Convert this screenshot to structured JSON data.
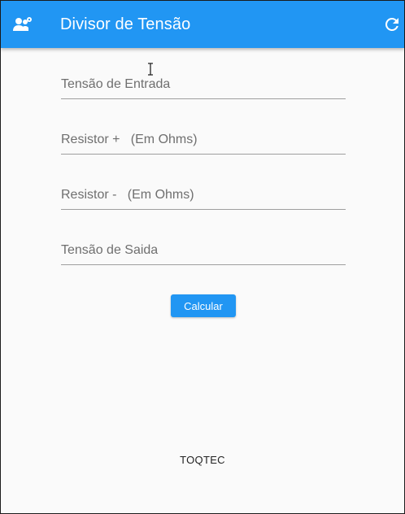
{
  "colors": {
    "primary": "#2196f3",
    "background": "#fafafa",
    "field_underline": "#9e9e9e",
    "placeholder_text": "#6f6f6f"
  },
  "appbar": {
    "title": "Divisor de Tensão",
    "left_icon": "people-settings-icon",
    "right_icon": "refresh-icon"
  },
  "form": {
    "fields": [
      {
        "placeholder": "Tensão de Entrada",
        "value": ""
      },
      {
        "placeholder": "Resistor +   (Em Ohms)",
        "value": ""
      },
      {
        "placeholder": "Resistor -   (Em Ohms)",
        "value": ""
      },
      {
        "placeholder": "Tensão de Saida",
        "value": ""
      }
    ],
    "submit_label": "Calcular"
  },
  "footer": {
    "text": "TOQTEC"
  },
  "pointer": {
    "icon": "text-cursor-icon"
  }
}
